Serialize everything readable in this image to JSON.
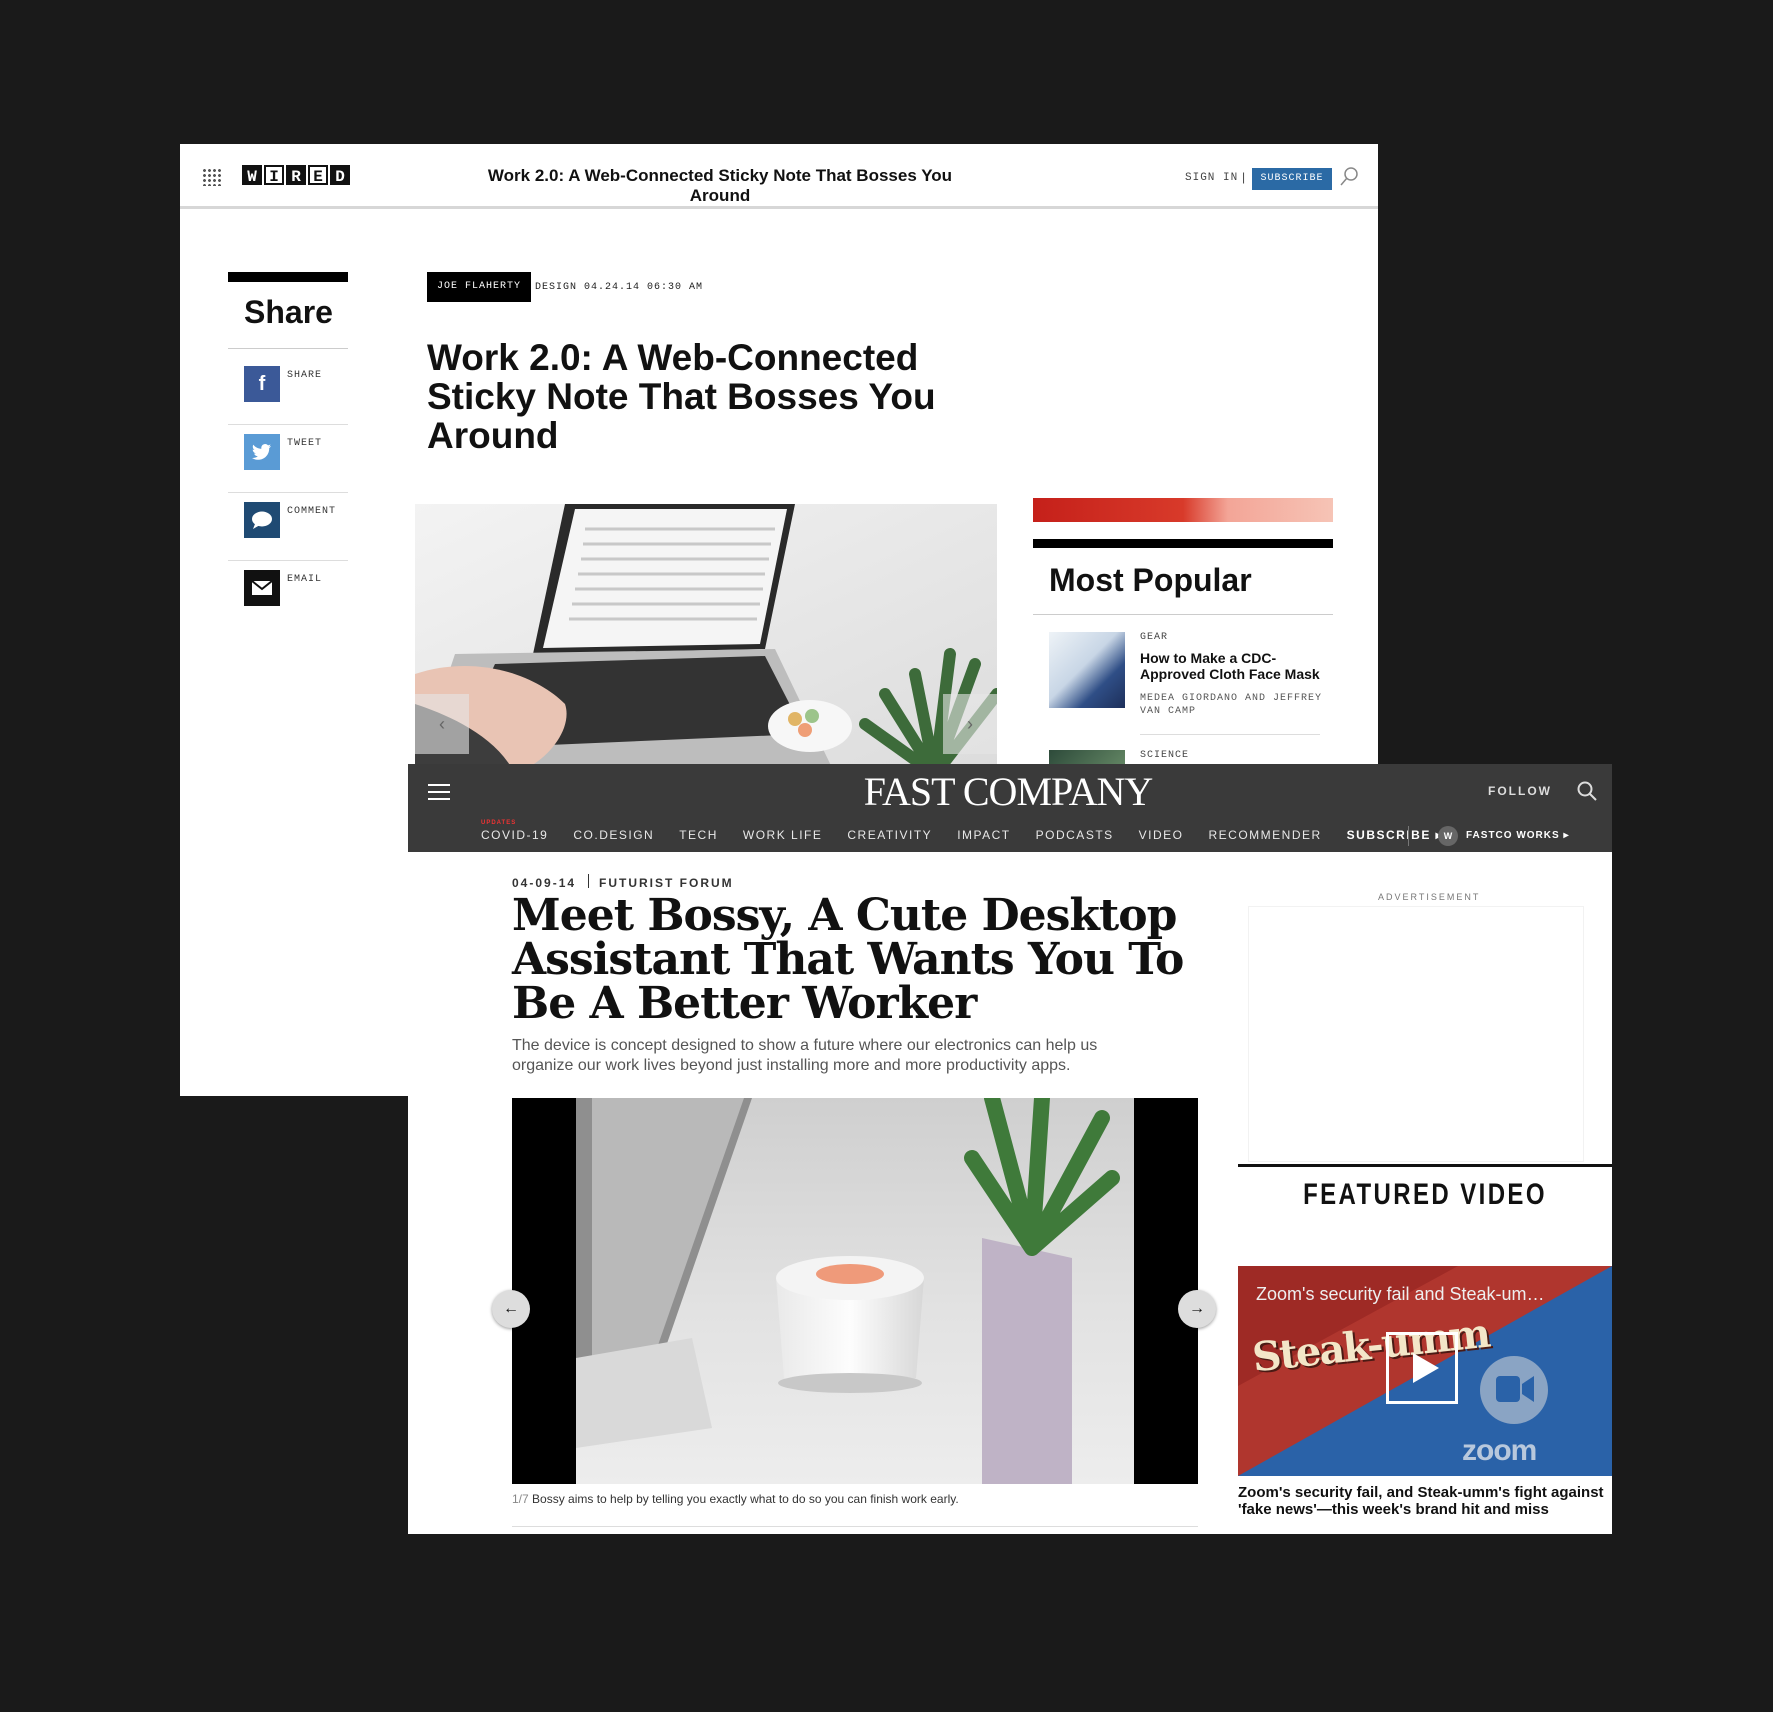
{
  "wired": {
    "logo_letters": [
      "W",
      "I",
      "R",
      "E",
      "D"
    ],
    "header_title": "Work 2.0: A Web-Connected Sticky Note That Bosses You Around",
    "sign_in": "SIGN IN",
    "separator": "|",
    "subscribe": "SUBSCRIBE",
    "share": {
      "title": "Share",
      "items": [
        {
          "label": "SHARE",
          "icon": "facebook-icon",
          "glyph": "f",
          "color": "#3b5998"
        },
        {
          "label": "TWEET",
          "icon": "twitter-icon",
          "glyph": "",
          "color": "#5a9bd5"
        },
        {
          "label": "COMMENT",
          "icon": "comment-icon",
          "glyph": "",
          "color": "#1f4a73"
        },
        {
          "label": "EMAIL",
          "icon": "email-icon",
          "glyph": "",
          "color": "#111111"
        }
      ]
    },
    "article": {
      "author": "JOE FLAHERTY",
      "meta": "DESIGN 04.24.14 06:30 AM",
      "headline": "Work 2.0: A Web-Connected Sticky Note That Bosses You Around"
    },
    "most_popular": {
      "title": "Most Popular",
      "items": [
        {
          "category": "GEAR",
          "headline": "How to Make a CDC-Approved Cloth Face Mask",
          "byline": "MEDEA GIORDANO AND JEFFREY VAN CAMP"
        },
        {
          "category": "SCIENCE"
        }
      ]
    },
    "colors": {
      "subscribe": "#2b6aa5",
      "popular_bar": "#c5201a"
    }
  },
  "fastcompany": {
    "logo": "FAST COMPANY",
    "follow": "FOLLOW",
    "updates_label": "UPDATES",
    "nav": [
      "COVID-19",
      "CO.DESIGN",
      "TECH",
      "WORK LIFE",
      "CREATIVITY",
      "IMPACT",
      "PODCASTS",
      "VIDEO",
      "RECOMMENDER"
    ],
    "subscribe": "SUBSCRIBE ▸",
    "works_badge": "W",
    "works": "FASTCO WORKS ▸",
    "date": "04-09-14",
    "category": "FUTURIST FORUM",
    "headline": "Meet Bossy, A Cute Desktop Assistant That Wants You To Be A Better Worker",
    "deck": "The device is concept designed to show a future where our electronics can help us organize our work lives beyond just installing more and more productivity apps.",
    "advertisement": "ADVERTISEMENT",
    "caption_index": "1/7",
    "caption": "Bossy aims to help by telling you exactly what to do so you can finish work early.",
    "featured_video": {
      "title": "FEATURED VIDEO",
      "overlay_title": "Zoom's security fail and Steak-um…",
      "brand_text": "Steak-umm",
      "zoom_text": "zoom",
      "caption": "Zoom's security fail, and Steak-umm's fight against 'fake news'—this week's brand hit and miss"
    },
    "colors": {
      "topbar": "#3a3a3a",
      "updates": "#e33333"
    }
  }
}
